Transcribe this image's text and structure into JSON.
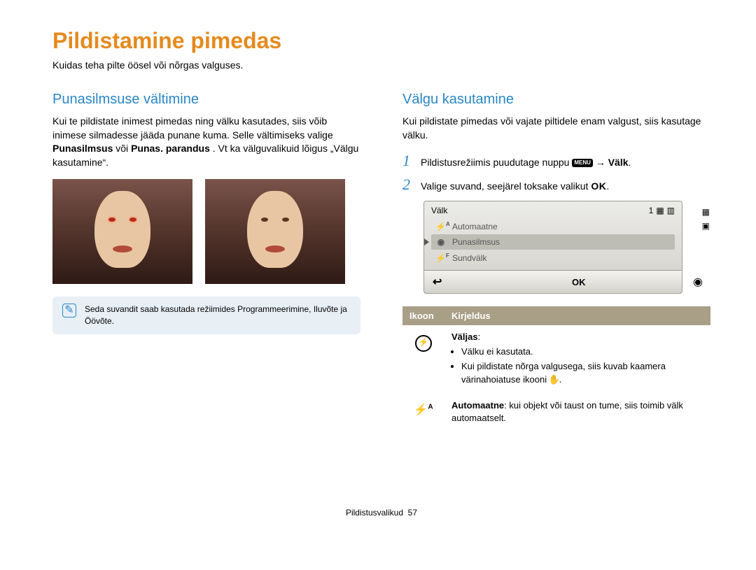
{
  "page": {
    "title": "Pildistamine pimedas",
    "subtitle": "Kuidas teha pilte öösel või nõrgas valguses."
  },
  "left": {
    "heading": "Punasilmsuse vältimine",
    "p1_a": "Kui te pildistate inimest pimedas ning välku kasutades, siis võib inimese silmadesse jääda punane kuma. Selle vältimiseks valige ",
    "p1_b": "Punasilmsus",
    "p1_c": " või ",
    "p1_d": "Punas. parandus",
    "p1_e": ". Vt ka välguvalikuid lõigus „Välgu kasutamine“.",
    "note": "Seda suvandit saab kasutada režiimides Programmeerimine, Iluvõte ja Öövõte."
  },
  "right": {
    "heading": "Välgu kasutamine",
    "intro": "Kui pildistate pimedas või vajate piltidele enam valgust, siis kasutage välku.",
    "step1_text": "Pildistusrežiimis puudutage nuppu ",
    "menu_chip": "MENU",
    "step1_arrow": " → ",
    "step1_bold": "Välk",
    "step1_end": ".",
    "step2_text": "Valige suvand, seejärel toksake valikut ",
    "step2_ok": "OK",
    "step2_end": ".",
    "camera": {
      "title": "Välk",
      "count": "1",
      "items": [
        "Automaatne",
        "Punasilmsus",
        "Sundvälk"
      ],
      "ok": "OK"
    },
    "table": {
      "h_icon": "Ikoon",
      "h_desc": "Kirjeldus",
      "rows": [
        {
          "icon": "off",
          "bold": "Väljas",
          "bullets": [
            "Välku ei kasutata.",
            "Kui pildistate nõrga valgusega, siis kuvab kaamera värinahoiatuse ikooni "
          ],
          "bullet2_end": "."
        },
        {
          "icon": "auto",
          "bold": "Automaatne",
          "plain": ": kui objekt või taust on tume, siis toimib välk automaatselt."
        }
      ]
    }
  },
  "footer": {
    "section": "Pildistusvalikud",
    "page_no": "57"
  }
}
